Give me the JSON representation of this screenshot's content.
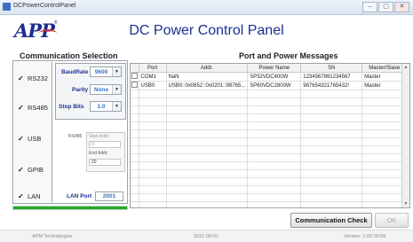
{
  "window": {
    "title": "DCPowerControlPanel",
    "buttons": [
      "–",
      "▢",
      "✕"
    ]
  },
  "logo": {
    "text": "APP",
    "reg": "®"
  },
  "app_title": "DC Power Control Panel",
  "comm": {
    "section_title": "Communication Selection",
    "items": [
      {
        "label": "RS232",
        "checked": true
      },
      {
        "label": "RS485",
        "checked": true
      },
      {
        "label": "USB",
        "checked": true
      },
      {
        "label": "GPIB",
        "checked": true
      },
      {
        "label": "LAN",
        "checked": true
      }
    ],
    "check_glyph": "✓",
    "baudrate_label": "BaudRate",
    "baudrate_value": "9600",
    "parity_label": "Parity",
    "parity_value": "None",
    "stopbits_label": "Stop Bits",
    "stopbits_value": "1.0",
    "rs485_label": "RS485",
    "start_addr_label": "Start Addr:",
    "start_addr_value": "0",
    "end_addr_label": "End Addr:",
    "end_addr_value": "20",
    "lan_port_label": "LAN Port",
    "lan_port_value": "2001",
    "progress": 1.0
  },
  "table": {
    "section_title": "Port and Power Messages",
    "columns": [
      "",
      "Port",
      "Addr.",
      "Power Name",
      "SN",
      "Master/Slave"
    ],
    "rows": [
      [
        "",
        "COM1",
        "NaN",
        "SP32VDC400W",
        "1234567891234567",
        "Master"
      ],
      [
        "",
        "USB0",
        "USB0::0x0652::0x0201::98765...",
        "SP60VDC2800W",
        "987654321765432!",
        "Master"
      ]
    ],
    "empty_rows": 17
  },
  "actions": {
    "check_label": "Communication Check",
    "ok_label": "OK"
  },
  "footer": {
    "company": "APM Technologies",
    "date": "2021-09-01",
    "version": "Version: 1.00.00.05"
  },
  "colors": {
    "brand_blue": "#1c2f8f",
    "value_blue": "#3a70c4",
    "progress_green": "#1fb026"
  }
}
